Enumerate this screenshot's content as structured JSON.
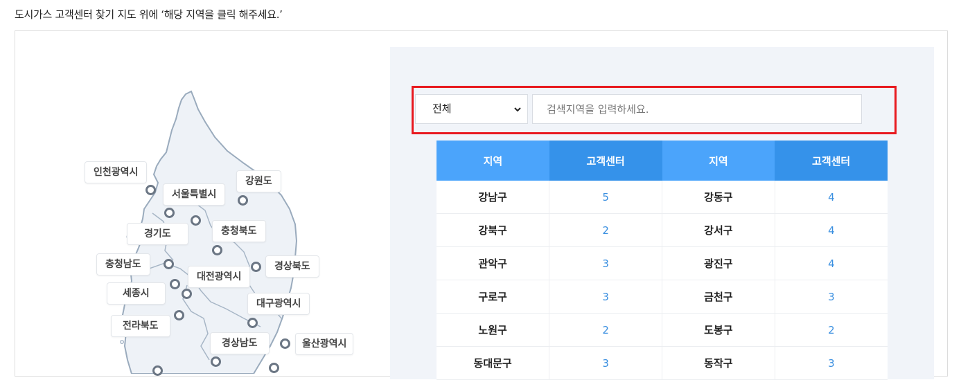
{
  "intro_text": "도시가스 고객센터 찾기 지도 위에 ‘해당 지역을 클릭 해주세요.’",
  "map": {
    "regions": [
      {
        "key": "incheon",
        "label": "인천광역시"
      },
      {
        "key": "seoul",
        "label": "서울특별시"
      },
      {
        "key": "gangwon",
        "label": "강원도"
      },
      {
        "key": "gyeonggi",
        "label": "경기도"
      },
      {
        "key": "chungbuk",
        "label": "충청북도"
      },
      {
        "key": "chungnam",
        "label": "충청남도"
      },
      {
        "key": "gyeongbuk",
        "label": "경상북도"
      },
      {
        "key": "daejeon",
        "label": "대전광역시"
      },
      {
        "key": "sejong",
        "label": "세종시"
      },
      {
        "key": "daegu",
        "label": "대구광역시"
      },
      {
        "key": "jeonbuk",
        "label": "전라북도"
      },
      {
        "key": "gyeongnam",
        "label": "경상남도"
      },
      {
        "key": "ulsan",
        "label": "울산광역시"
      }
    ]
  },
  "search": {
    "selected_region": "전체",
    "placeholder": "검색지역을 입력하세요.",
    "select_icon": "chevron-down-icon"
  },
  "table": {
    "headers": [
      "지역",
      "고객센터",
      "지역",
      "고객센터"
    ],
    "rows": [
      [
        "강남구",
        "5",
        "강동구",
        "4"
      ],
      [
        "강북구",
        "2",
        "강서구",
        "4"
      ],
      [
        "관악구",
        "3",
        "광진구",
        "4"
      ],
      [
        "구로구",
        "3",
        "금천구",
        "3"
      ],
      [
        "노원구",
        "2",
        "도봉구",
        "2"
      ],
      [
        "동대문구",
        "3",
        "동작구",
        "3"
      ]
    ]
  },
  "colors": {
    "header_dark": "#3592ea",
    "header_light": "#4ba4fb",
    "count_text": "#3a8fe0",
    "highlight_border": "#e8191f",
    "panel_bg": "#f1f4f9"
  }
}
